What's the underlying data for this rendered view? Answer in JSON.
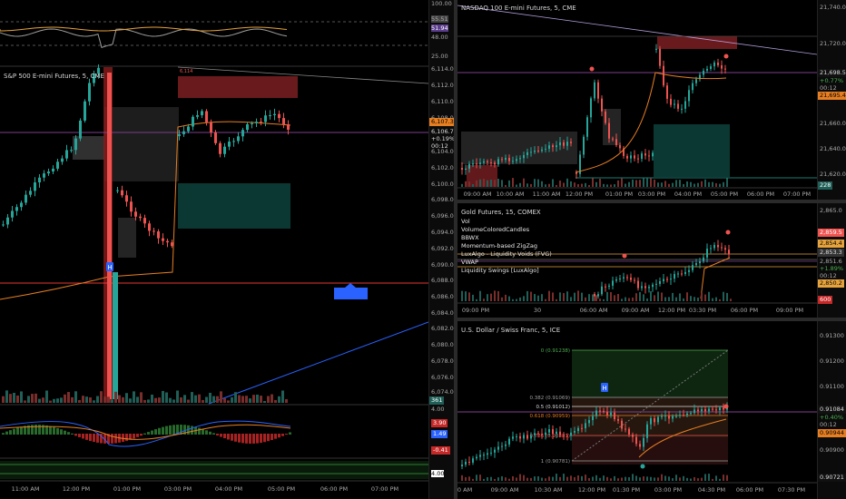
{
  "colors": {
    "bull": "#26a69a",
    "bear": "#ef5350",
    "bg": "#000000",
    "accent_blue": "#2962ff"
  },
  "sp500": {
    "title": "S&P 500 E-mini Futures, 5, CME",
    "y_ticks": [
      "6,114.00",
      "6,112.00",
      "6,110.00",
      "6,108.00",
      "6,104.00",
      "6,102.00",
      "6,100.00",
      "6,098.00",
      "6,096.00",
      "6,094.00",
      "6,092.00",
      "6,090.00",
      "6,088.00",
      "6,086.00",
      "6,084.00",
      "6,082.00",
      "6,080.00",
      "6,078.00",
      "6,076.00",
      "6,074.00"
    ],
    "price_tag": "6,107.38",
    "last": "6,106.75",
    "change": "+0.19%",
    "timer": "00:12",
    "vol_tag": "361",
    "x_ticks": [
      "11:00 AM",
      "12:00 PM",
      "01:00 PM",
      "03:00 PM",
      "04:00 PM",
      "05:00 PM",
      "06:00 PM",
      "07:00 PM"
    ],
    "osc_ticks": [
      "100.00",
      "55.51",
      "51.94",
      "48.00",
      "25.00",
      "0.00"
    ],
    "osc2_ticks": [
      "4.00",
      "3.90",
      "1.49",
      "-0.41",
      "4.00"
    ],
    "marker_label": "H",
    "high_label": "6,114"
  },
  "nasdaq": {
    "title": "NASDAQ 100 E-mini Futures, 5, CME",
    "y_ticks": [
      "21,740.00",
      "21,720.00",
      "21,700.00",
      "21,680.00",
      "21,660.00",
      "21,640.00",
      "21,620.00"
    ],
    "price_tag": "21,698.50",
    "change": "+0.77%",
    "timer": "00:12",
    "price_tag2": "21,695.47",
    "vol_tag": "228",
    "x_ticks": [
      "09:00 AM",
      "10:00 AM",
      "11:00 AM",
      "12:00 PM",
      "01:00 PM",
      "03:00 PM",
      "04:00 PM",
      "05:00 PM",
      "06:00 PM",
      "07:00 PM"
    ]
  },
  "gold": {
    "title": "Gold Futures, 15, COMEX",
    "indicators": [
      "Vol",
      "VolumeColoredCandles",
      "BBWX",
      "Momentum-based ZigZag",
      "LuxAlgo - Liquidity Voids (FVG)",
      "VWAP",
      "Liquidity Swings [LuxAlgo]"
    ],
    "y_ticks": [
      "2,865.0",
      "2,859.5",
      "2,854.4",
      "2,853.3",
      "2,851.6",
      "2,850.2"
    ],
    "change": "+1.89%",
    "timer": "00:12",
    "vol_tag": "600",
    "x_ticks": [
      "09:00 PM",
      "30",
      "06:00 AM",
      "09:00 AM",
      "12:00 PM",
      "03:30 PM",
      "06:00 PM",
      "09:00 PM"
    ]
  },
  "usdchf": {
    "title": "U.S. Dollar / Swiss Franc, 5, ICE",
    "y_ticks": [
      "0.91300",
      "0.91200",
      "0.91100",
      "0.91000",
      "0.90900",
      "0.90800"
    ],
    "price_tag": "0.91084",
    "change": "+0.40%",
    "timer": "00:12",
    "price_tag2": "0.90944",
    "low_tag": "0.90721",
    "fib_levels": [
      "0 (0.91238)",
      "0.382 (0.91069)",
      "0.5 (0.91012)",
      "0.618 (0.90959)",
      "0.786 (0.90883)",
      "1 (0.90781)"
    ],
    "x_ticks": [
      "10 AM",
      "09:00 AM",
      "10:30 AM",
      "12:00 PM",
      "01:30 PM",
      "03:00 PM",
      "04:30 PM",
      "06:00 PM",
      "07:30 PM"
    ],
    "marker_label": "H"
  }
}
